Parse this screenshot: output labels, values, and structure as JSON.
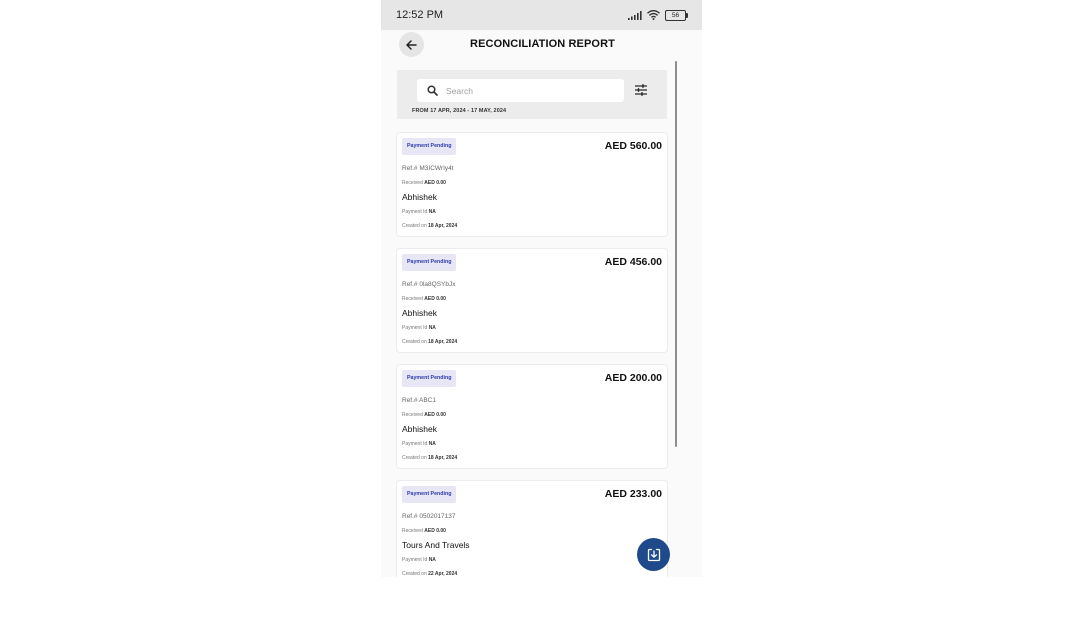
{
  "status_bar": {
    "time": "12:52 PM",
    "battery": "56"
  },
  "header": {
    "title": "RECONCILIATION REPORT"
  },
  "search": {
    "placeholder": "Search",
    "value": ""
  },
  "date_range": "FROM 17 APR, 2024 - 17 MAY, 2024",
  "labels": {
    "ref_prefix": "Ref.#",
    "received": "Received",
    "payment_id": "Payment Id",
    "created_on": "Created on"
  },
  "records": [
    {
      "status": "Payment Pending",
      "amount": "AED 560.00",
      "ref": "M3ICWrIy4t",
      "received": "AED 0.00",
      "name": "Abhishek",
      "payment_id": "NA",
      "created": "18 Apr, 2024"
    },
    {
      "status": "Payment Pending",
      "amount": "AED 456.00",
      "ref": "0la8QSYbJx",
      "received": "AED 0.00",
      "name": "Abhishek",
      "payment_id": "NA",
      "created": "18 Apr, 2024"
    },
    {
      "status": "Payment Pending",
      "amount": "AED 200.00",
      "ref": "ABC1",
      "received": "AED 0.00",
      "name": "Abhishek",
      "payment_id": "NA",
      "created": "18 Apr, 2024"
    },
    {
      "status": "Payment Pending",
      "amount": "AED 233.00",
      "ref": "0502017137",
      "received": "AED 0.00",
      "name": "Tours And Travels",
      "payment_id": "NA",
      "created": "22 Apr, 2024"
    }
  ],
  "icons": {
    "back": "arrow-left-icon",
    "search": "search-icon",
    "filter": "sliders-icon",
    "download": "download-icon",
    "signal": "signal-icon",
    "wifi": "wifi-icon",
    "battery": "battery-icon"
  },
  "colors": {
    "badge_bg": "#e6e6f5",
    "badge_text": "#2e3aa8",
    "fab": "#1e4a8c"
  }
}
